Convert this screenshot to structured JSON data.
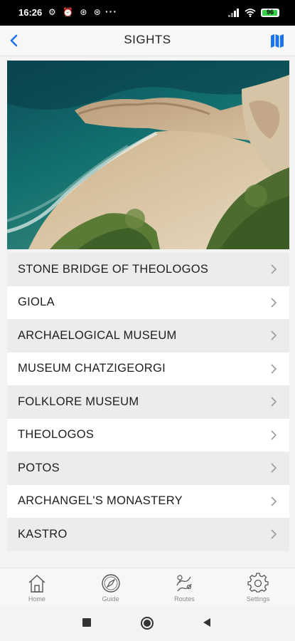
{
  "status_bar": {
    "time": "16:26",
    "left_icons": "⚙ ⏰ ⊛ ⊛",
    "more": "···",
    "battery": "96",
    "battery_level": 0.96,
    "battery_color": "#37d04b"
  },
  "header": {
    "title": "SIGHTS",
    "accent_color": "#1a73e8",
    "back_icon": "chevron-left-icon",
    "map_icon": "map-icon"
  },
  "hero": {
    "icon": "beach-photo"
  },
  "sights": [
    {
      "label": "STONE BRIDGE OF THEOLOGOS"
    },
    {
      "label": "GIOLA"
    },
    {
      "label": "ARCHAELOGICAL MUSEUM"
    },
    {
      "label": "MUSEUM CHATZIGEORGI"
    },
    {
      "label": "FOLKLORE MUSEUM"
    },
    {
      "label": "THEOLOGOS"
    },
    {
      "label": "POTOS"
    },
    {
      "label": "ARCHANGEL'S MONASTERY"
    },
    {
      "label": "KASTRO"
    }
  ],
  "bottom_nav": {
    "items": [
      {
        "label": "Home",
        "icon": "home-icon"
      },
      {
        "label": "Guide",
        "icon": "compass-icon"
      },
      {
        "label": "Routes",
        "icon": "routes-icon"
      },
      {
        "label": "Settings",
        "icon": "gear-icon"
      }
    ]
  }
}
